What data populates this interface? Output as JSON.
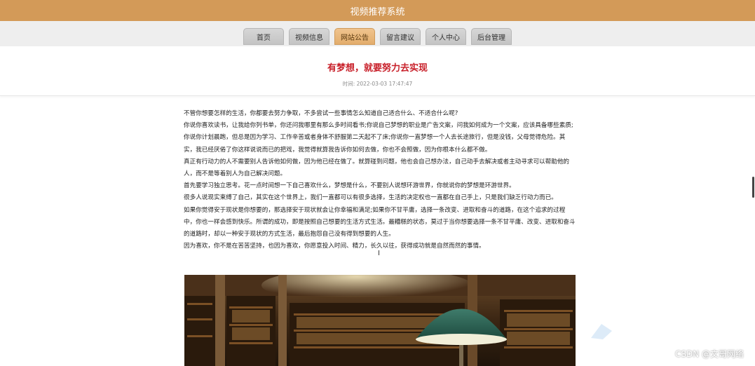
{
  "app": {
    "title": "视频推荐系统"
  },
  "nav": {
    "items": [
      {
        "label": "首页",
        "active": false
      },
      {
        "label": "视频信息",
        "active": false
      },
      {
        "label": "网站公告",
        "active": true
      },
      {
        "label": "留言建议",
        "active": false
      },
      {
        "label": "个人中心",
        "active": false
      },
      {
        "label": "后台管理",
        "active": false
      }
    ]
  },
  "article": {
    "title": "有梦想，就要努力去实现",
    "meta": "时间: 2022-03-03 17:47:47",
    "paragraphs": [
      "不管你想要怎样的生活，你都要去努力争取，不多尝试一些事情怎么知道自己适合什么、不适合什么呢?",
      "你说你喜欢读书，让我给你列书单，你还问我哪里有那么多时间看书;你说自己梦想的职业是广告文案，问我如何成为一个文案，应该具备哪些素质;你说你计划晨跑，但总是因为学习、工作辛苦或者身体不舒服第二天起不了床;你说你一直梦想一个人去长途旅行，但是没钱，父母觉得危险。其实，我已经厌倦了你这样说说而已的把戏，我觉得就算我告诉你如何去做，你也不会照做，因为你根本什么都不做。",
      "真正有行动力的人不需要别人告诉他如何做，因为他已经在做了。就算碰到问题，他也会自己想办法，自己动手去解决或者主动寻求可以帮助他的人，而不是等着别人为自己解决问题。",
      "首先要学习独立思考。花一点时间想一下自己喜欢什么，梦想是什么，不要别人说想环游世界，你就说你的梦想是环游世界。",
      "很多人说现实束缚了自己，其实在这个世界上，我们一直都可以有很多选择，生活的决定权也一直都在自己手上，只是我们缺乏行动力而已。",
      "如果你觉得安于现状是你想要的，那选择安于现状就会让你幸福和满足;如果你不甘平庸，选择一条改变、进取和奋斗的道路，在这个追求的过程中，你也一样会感到快乐。所谓的成功，即是按照自己想要的生活方式生活。最糟糕的状态，莫过于当你想要选择一条不甘平庸、改变、进取和奋斗的道路时，却以一种安于现状的方式生活，最后抱怨自己没有得到想要的人生。",
      "因为喜欢，你不是在苦苦坚持，也因为喜欢，你愿意投入时间、精力，长久以往，获得成功就是自然而然的事情。"
    ]
  },
  "watermark": "CSDN @文哥网络",
  "colors": {
    "topbar": "#d39a58",
    "title_red": "#c8202a",
    "active_tab": "#e3ad6c"
  }
}
